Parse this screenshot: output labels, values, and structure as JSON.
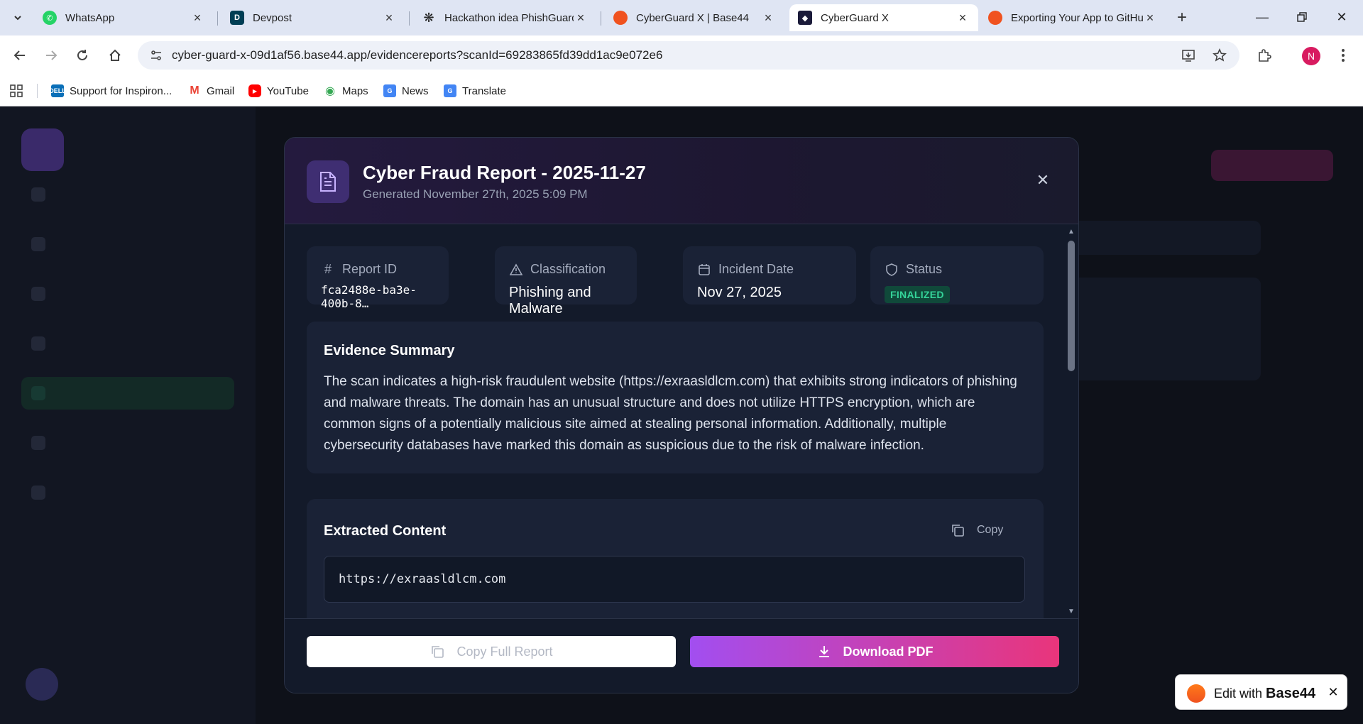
{
  "browser": {
    "tabs": [
      {
        "title": "WhatsApp",
        "icon": "whatsapp-icon"
      },
      {
        "title": "Devpost",
        "icon": "devpost-icon"
      },
      {
        "title": "Hackathon idea PhishGuard",
        "icon": "openai-icon"
      },
      {
        "title": "CyberGuard X | Base44",
        "icon": "base44-icon"
      },
      {
        "title": "CyberGuard X",
        "icon": "cyberguard-icon",
        "active": true
      },
      {
        "title": "Exporting Your App to GitHub",
        "icon": "base44-icon"
      }
    ],
    "url": "cyber-guard-x-09d1af56.base44.app/evidencereports?scanId=69283865fd39dd1ac9e072e6",
    "profile_initial": "N",
    "bookmarks": [
      {
        "label": "Support for Inspiron...",
        "icon": "dell-icon"
      },
      {
        "label": "Gmail",
        "icon": "gmail-icon"
      },
      {
        "label": "YouTube",
        "icon": "youtube-icon"
      },
      {
        "label": "Maps",
        "icon": "maps-icon"
      },
      {
        "label": "News",
        "icon": "news-icon"
      },
      {
        "label": "Translate",
        "icon": "translate-icon"
      }
    ]
  },
  "modal": {
    "title": "Cyber Fraud Report - 2025-11-27",
    "subtitle": "Generated November 27th, 2025 5:09 PM",
    "info": {
      "report_id": {
        "label": "Report ID",
        "value": "fca2488e-ba3e-400b-8…"
      },
      "classification": {
        "label": "Classification",
        "value": "Phishing and Malware"
      },
      "incident_date": {
        "label": "Incident Date",
        "value": "Nov 27, 2025"
      },
      "status": {
        "label": "Status",
        "value": "FINALIZED"
      }
    },
    "evidence_summary": {
      "title": "Evidence Summary",
      "text": "The scan indicates a high-risk fraudulent website (https://exraasldlcm.com) that exhibits strong indicators of phishing and malware threats. The domain has an unusual structure and does not utilize HTTPS encryption, which are common signs of a potentially malicious site aimed at stealing personal information. Additionally, multiple cybersecurity databases have marked this domain as suspicious due to the risk of malware infection."
    },
    "extracted_content": {
      "title": "Extracted Content",
      "copy_label": "Copy",
      "content": "https://exraasldlcm.com"
    },
    "footer": {
      "copy_full_label": "Copy Full Report",
      "download_label": "Download PDF"
    }
  },
  "base44_badge": {
    "prefix": "Edit with",
    "brand": "Base44"
  },
  "colors": {
    "accent_purple": "#a24ef0",
    "accent_pink": "#e9357b",
    "status_green": "#34d399",
    "modal_bg": "#131a2a"
  }
}
